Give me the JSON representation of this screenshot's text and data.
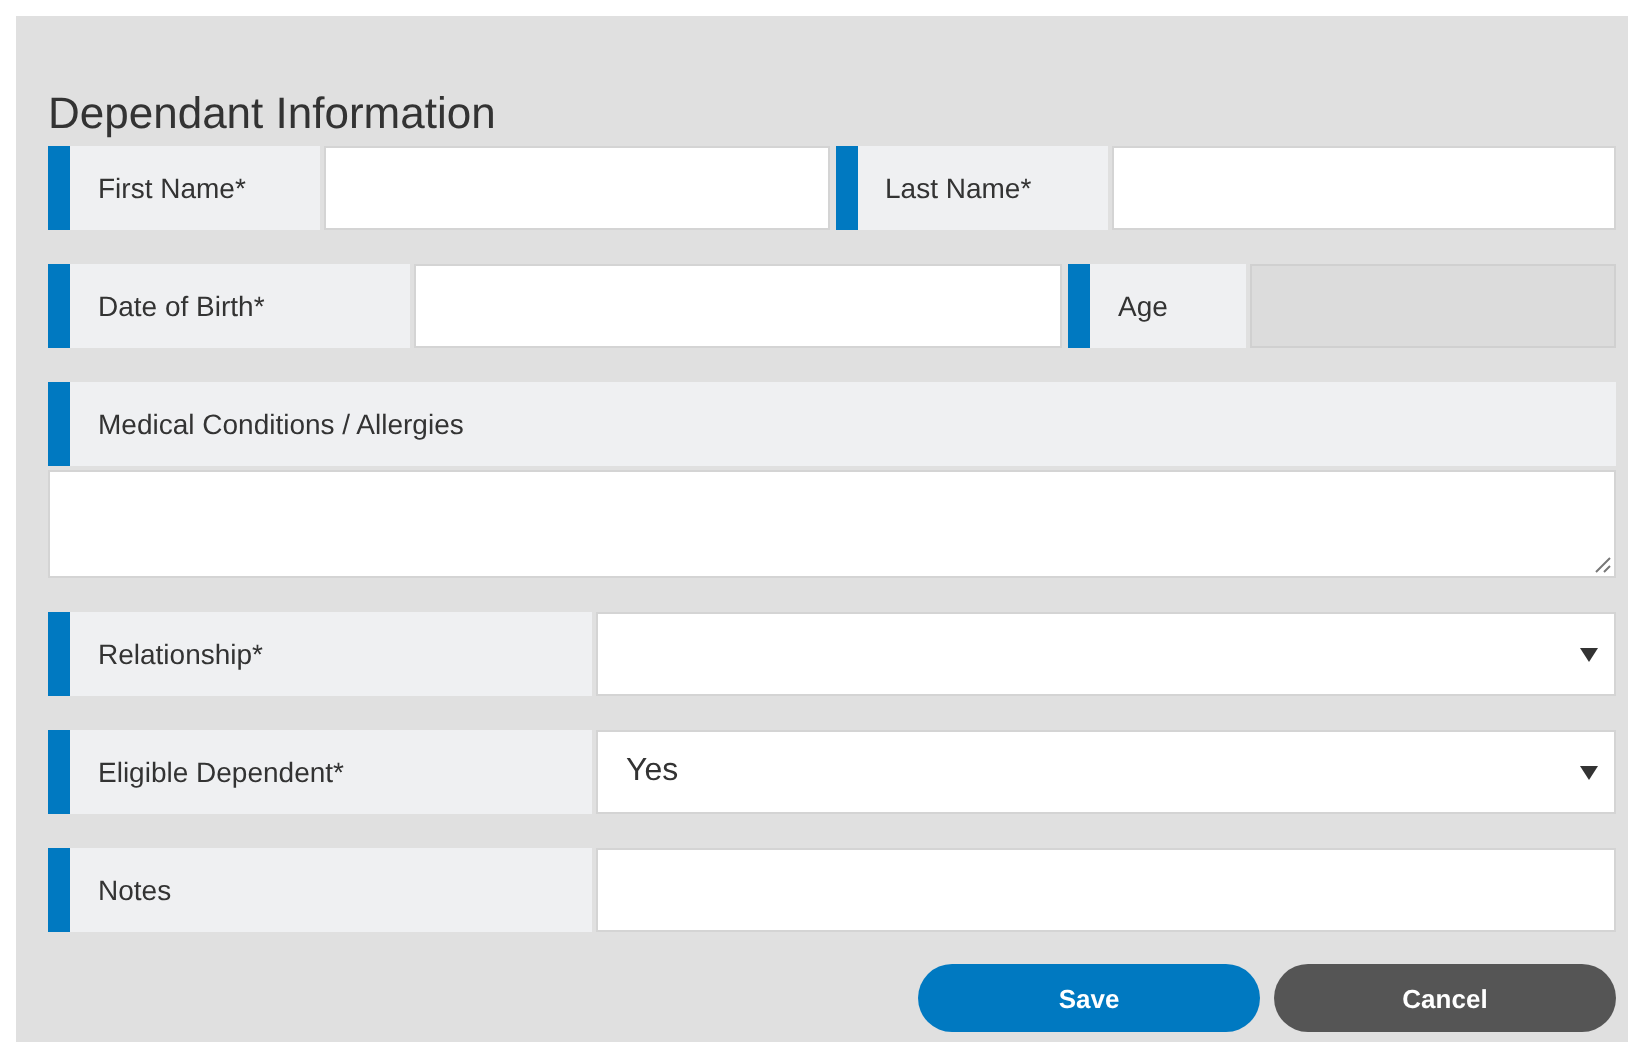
{
  "title": "Dependant Information",
  "rows": [
    {
      "fields": [
        {
          "label": "First Name*",
          "kind": "text",
          "disabled": false
        },
        {
          "label": "Last Name*",
          "kind": "text",
          "disabled": false
        }
      ]
    },
    {
      "fields": [
        {
          "label": "Date of Birth*",
          "kind": "text",
          "disabled": false
        },
        {
          "label": "Age",
          "kind": "text",
          "disabled": true
        }
      ]
    },
    {
      "fields": [
        {
          "label": "Medical Conditions / Allergies",
          "kind": "textarea",
          "disabled": false
        }
      ]
    },
    {
      "fields": [
        {
          "label": "Relationship*",
          "kind": "select",
          "disabled": false
        }
      ]
    },
    {
      "fields": [
        {
          "label": "Eligible Dependent*",
          "kind": "select",
          "disabled": false,
          "value": "Yes"
        }
      ]
    },
    {
      "fields": [
        {
          "label": "Notes",
          "kind": "text",
          "disabled": false
        }
      ]
    }
  ],
  "buttons": [
    {
      "label": "Save",
      "kind": "primary"
    },
    {
      "label": "Cancel",
      "kind": "secondary"
    }
  ]
}
